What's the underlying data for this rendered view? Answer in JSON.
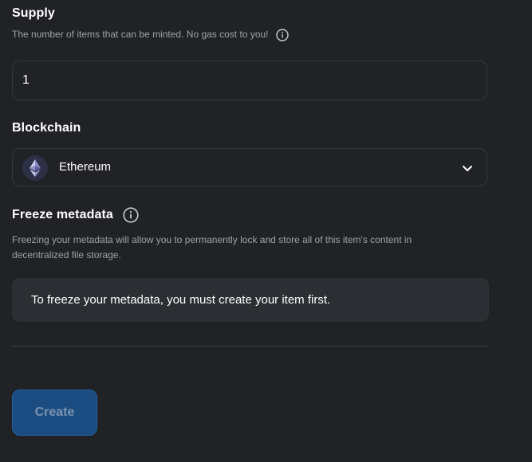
{
  "supply": {
    "title": "Supply",
    "description": "The number of items that can be minted. No gas cost to you!",
    "value": "1",
    "info_icon": "info-icon"
  },
  "blockchain": {
    "title": "Blockchain",
    "selected": "Ethereum",
    "selected_icon": "ethereum-icon",
    "dropdown_icon": "chevron-down-icon"
  },
  "freeze": {
    "title": "Freeze metadata",
    "description_line1": "Freezing your metadata will allow you to permanently lock and store all of this item's content in",
    "description_line2": "decentralized file storage.",
    "notice": "To freeze your metadata, you must create your item first.",
    "info_icon": "info-icon"
  },
  "actions": {
    "create_label": "Create",
    "create_disabled": true
  },
  "colors": {
    "background": "#202225",
    "field_border": "#353840",
    "notice_bg": "#2b2e33",
    "button_bg": "#1c4d82",
    "button_text": "#7c93b0",
    "muted_text": "#9ea3ab"
  }
}
